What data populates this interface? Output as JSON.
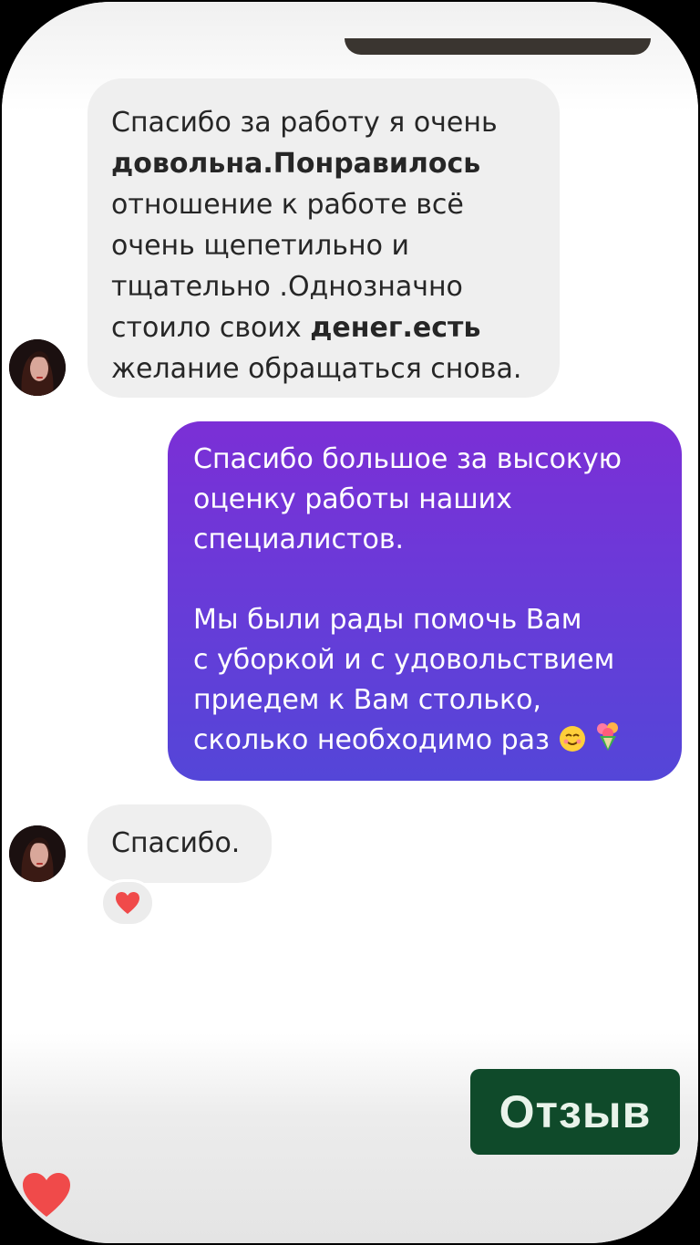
{
  "messages": {
    "first": {
      "l1": "Спасибо за работу я очень",
      "l2": "довольна.Понравилось",
      "l3": "отношение к работе всё",
      "l4": "очень щепетильно и",
      "l5": "тщательно .Однозначно",
      "l6a": "стоило своих ",
      "l6b": "денег.есть",
      "l7": "желание обращаться снова."
    },
    "reply": {
      "p1l1": "Спасибо большое за высокую",
      "p1l2": "оценку работы наших",
      "p1l3": "специалистов.",
      "p2l1": "Мы были рады помочь Вам",
      "p2l2": "с уборкой и с удовольствием",
      "p2l3": "приедем к Вам столько,",
      "p2l4": "сколько необходимо раз"
    },
    "short": "Спасибо."
  },
  "review_button": "Отзыв",
  "colors": {
    "incoming_bubble": "#efefef",
    "outgoing_gradient_top": "#7b2fd6",
    "outgoing_gradient_bottom": "#5446d8",
    "review_button_bg": "#0f4a2a",
    "heart": "#f04a4a"
  },
  "icons": {
    "reaction": "red-heart-icon",
    "reply_emojis": [
      "smiling-face-icon",
      "bouquet-icon"
    ],
    "like": "heart-icon"
  }
}
